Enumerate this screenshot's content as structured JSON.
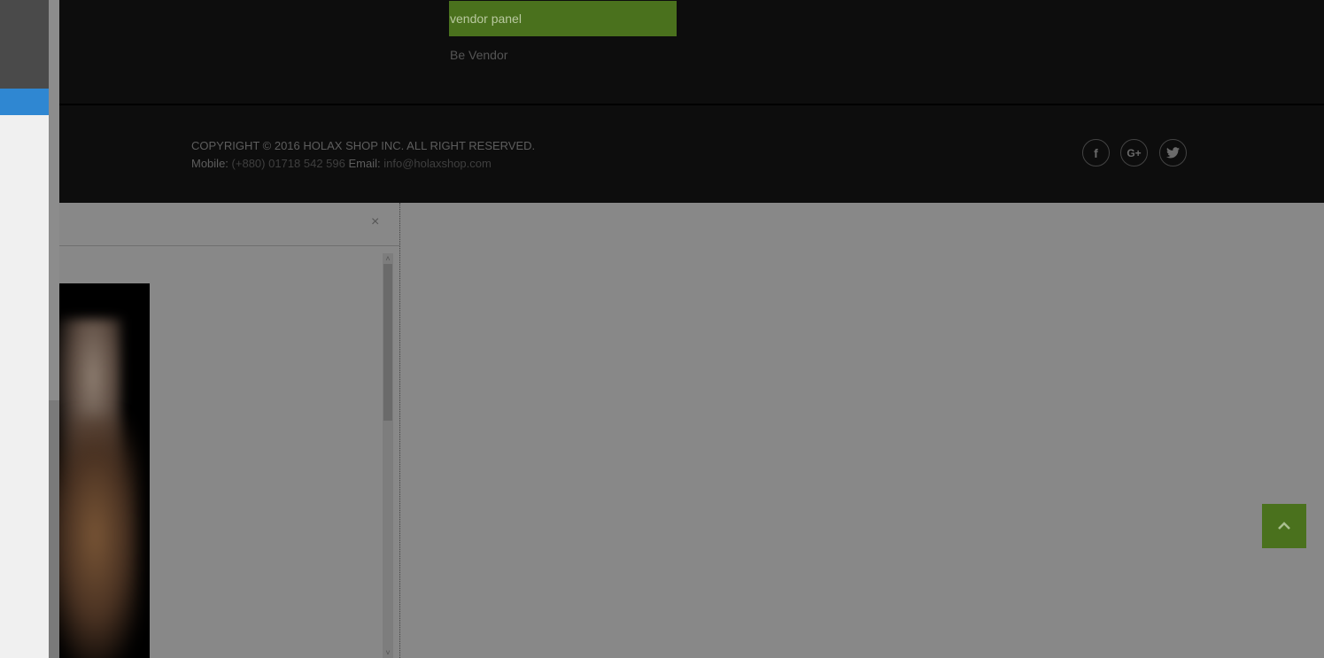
{
  "footer": {
    "links": {
      "vendor_panel": "vendor panel",
      "be_vendor": "Be Vendor"
    },
    "copyright": "COPYRIGHT © 2016 HOLAX SHOP INC. ALL RIGHT RESERVED.",
    "contact": {
      "mobile_label": "Mobile:",
      "mobile_value": "(+880) 01718 542 596",
      "email_label": "Email:",
      "email_value": "info@holaxshop.com"
    },
    "social": [
      {
        "icon": "facebook-icon",
        "glyph": "f"
      },
      {
        "icon": "google-plus-icon",
        "glyph": "G+"
      },
      {
        "icon": "twitter-icon",
        "glyph": "🐦"
      }
    ]
  },
  "modal": {
    "close_glyph": "×",
    "scroll_up_glyph": "˄",
    "scroll_down_glyph": "˅"
  },
  "back_to_top": {
    "glyph": "⌃",
    "icon": "chevron-up-icon"
  },
  "colors": {
    "accent_green": "#4a711d",
    "overlay_gray": "#888888",
    "footer_bg": "#0d0d0d",
    "blue_tab": "#2f87d2"
  }
}
